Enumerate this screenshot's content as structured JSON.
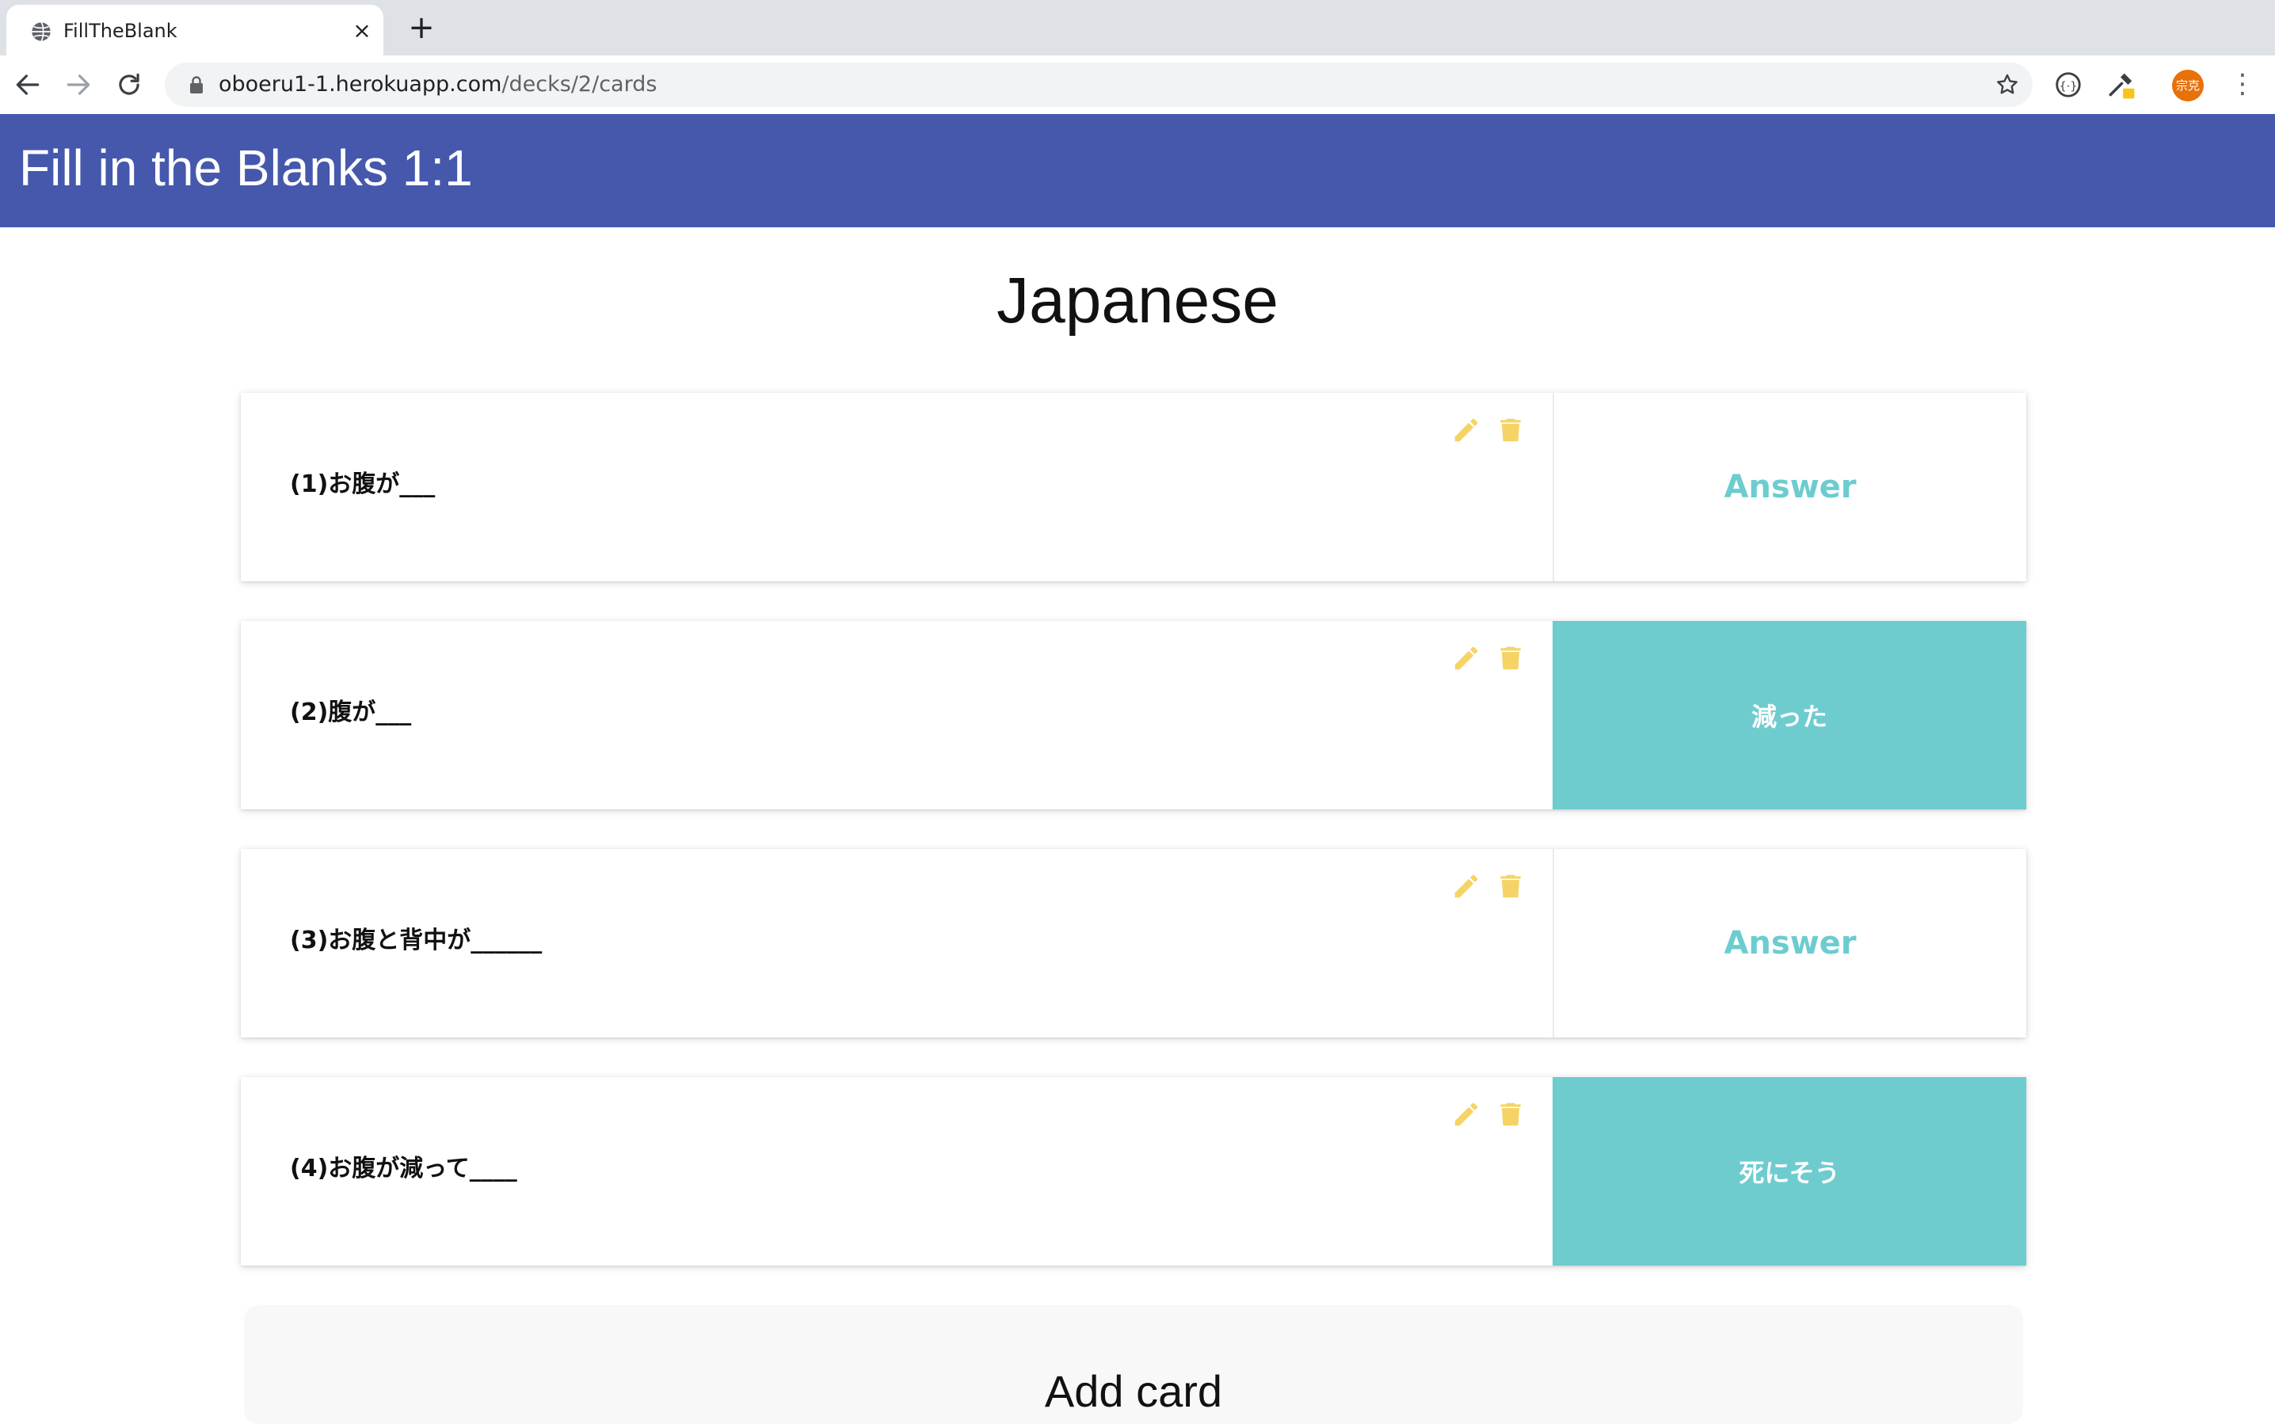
{
  "browser": {
    "tab_title": "FillTheBlank",
    "tab_close": "×",
    "new_tab": "+",
    "url_host": "oboeru1-1.herokuapp.com",
    "url_path": "/decks/2/cards",
    "profile_initials": "宗克",
    "menu": "⋮"
  },
  "header": {
    "title": "Fill in the Blanks 1:1"
  },
  "deck": {
    "title": "Japanese"
  },
  "cards": [
    {
      "question": "(1)お腹が___",
      "answer": "Answer",
      "revealed": false
    },
    {
      "question": "(2)腹が___",
      "answer": "減った",
      "revealed": true
    },
    {
      "question": "(3)お腹と背中が______",
      "answer": "Answer",
      "revealed": false
    },
    {
      "question": "(4)お腹が減って____",
      "answer": "死にそう",
      "revealed": true
    }
  ],
  "add_card": {
    "label": "Add card"
  },
  "colors": {
    "header_bg": "#4558ac",
    "accent_teal": "#6ecccf",
    "icon_yellow": "#f6d365",
    "profile": "#e8710a"
  },
  "icons": {
    "edit": "pencil-icon",
    "delete": "trash-icon"
  }
}
